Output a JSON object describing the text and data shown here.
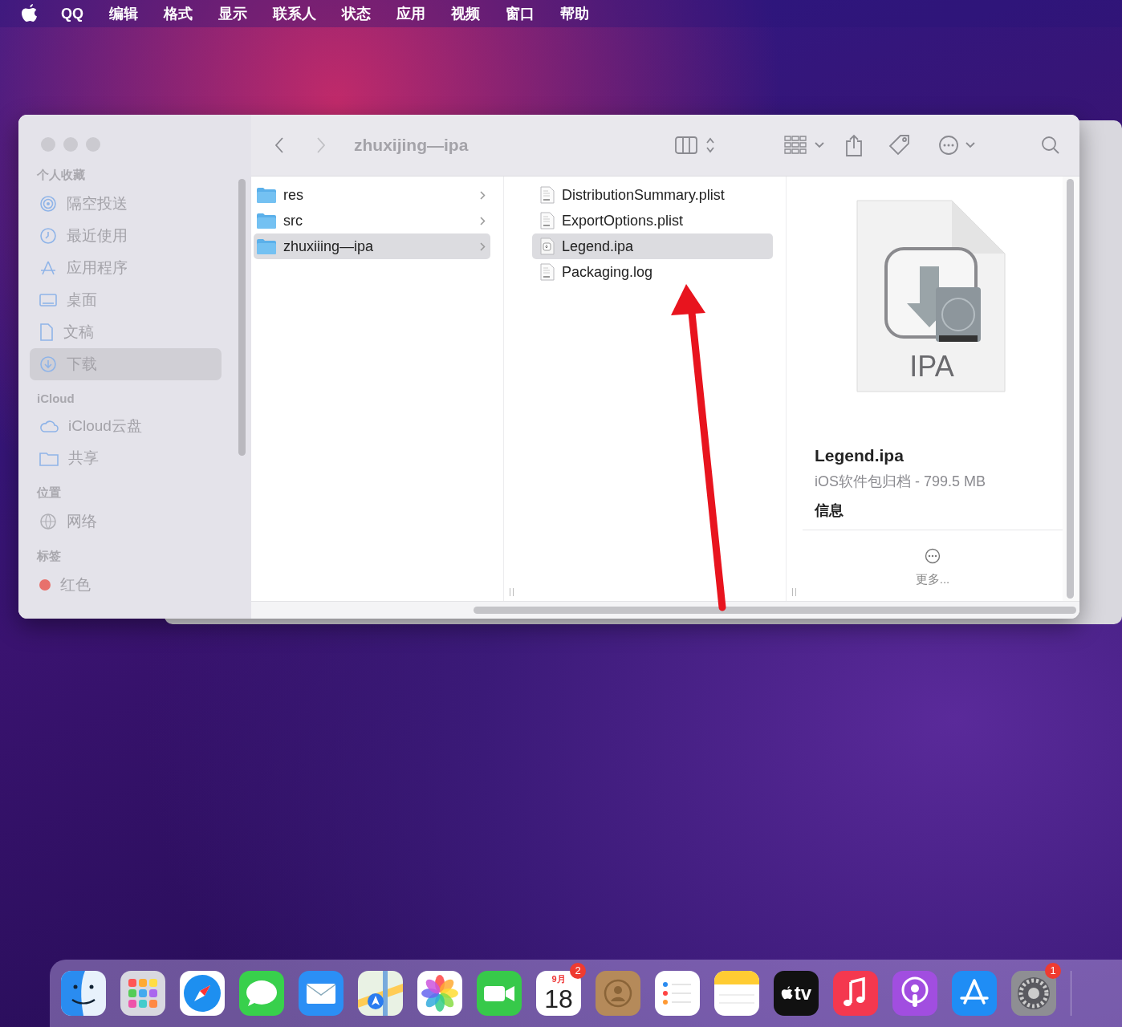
{
  "menu_bar": {
    "items": [
      "QQ",
      "编辑",
      "格式",
      "显示",
      "联系人",
      "状态",
      "应用",
      "视频",
      "窗口",
      "帮助"
    ]
  },
  "finder": {
    "title": "zhuxijing—ipa",
    "sidebar": [
      {
        "heading": "个人收藏",
        "items": [
          {
            "label": "隔空投送",
            "kind": "airdrop",
            "selected": false
          },
          {
            "label": "最近使用",
            "kind": "clock",
            "selected": false
          },
          {
            "label": "应用程序",
            "kind": "apps",
            "selected": false
          },
          {
            "label": "桌面",
            "kind": "desktop",
            "selected": false
          },
          {
            "label": "文稿",
            "kind": "document",
            "selected": false
          },
          {
            "label": "下载",
            "kind": "download",
            "selected": true
          }
        ]
      },
      {
        "heading": "iCloud",
        "items": [
          {
            "label": "iCloud云盘",
            "kind": "cloud",
            "selected": false
          },
          {
            "label": "共享",
            "kind": "shared",
            "selected": false
          }
        ]
      },
      {
        "heading": "位置",
        "items": [
          {
            "label": "网络",
            "kind": "network",
            "selected": false
          }
        ]
      },
      {
        "heading": "标签",
        "items": [
          {
            "label": "红色",
            "kind": "tag",
            "color": "#e8716c",
            "selected": false
          }
        ]
      }
    ],
    "columns": [
      [
        {
          "name": "res",
          "kind": "folder",
          "selected": false
        },
        {
          "name": "src",
          "kind": "folder",
          "selected": false
        },
        {
          "name": "zhuxiiing—ipa",
          "kind": "folder",
          "selected": true
        }
      ],
      [
        {
          "name": "DistributionSummary.plist",
          "kind": "file",
          "selected": false
        },
        {
          "name": "ExportOptions.plist",
          "kind": "file",
          "selected": false
        },
        {
          "name": "Legend.ipa",
          "kind": "package",
          "selected": true
        },
        {
          "name": "Packaging.log",
          "kind": "file",
          "selected": false
        }
      ]
    ],
    "preview": {
      "type_label": "IPA",
      "name": "Legend.ipa",
      "info": "iOS软件包归档 - 799.5 MB",
      "section": "信息",
      "more": "更多..."
    }
  },
  "dock": {
    "apps": [
      {
        "kind": "finder"
      },
      {
        "kind": "launchpad"
      },
      {
        "kind": "safari"
      },
      {
        "kind": "messages"
      },
      {
        "kind": "mail"
      },
      {
        "kind": "maps"
      },
      {
        "kind": "photos"
      },
      {
        "kind": "facetime"
      },
      {
        "kind": "calendar",
        "month": "9月",
        "day": "18",
        "badge": "2"
      },
      {
        "kind": "contacts"
      },
      {
        "kind": "reminders"
      },
      {
        "kind": "notes"
      },
      {
        "kind": "tv",
        "label": "tv"
      },
      {
        "kind": "music"
      },
      {
        "kind": "podcasts"
      },
      {
        "kind": "appstore"
      },
      {
        "kind": "settings",
        "badge": "1"
      }
    ]
  }
}
